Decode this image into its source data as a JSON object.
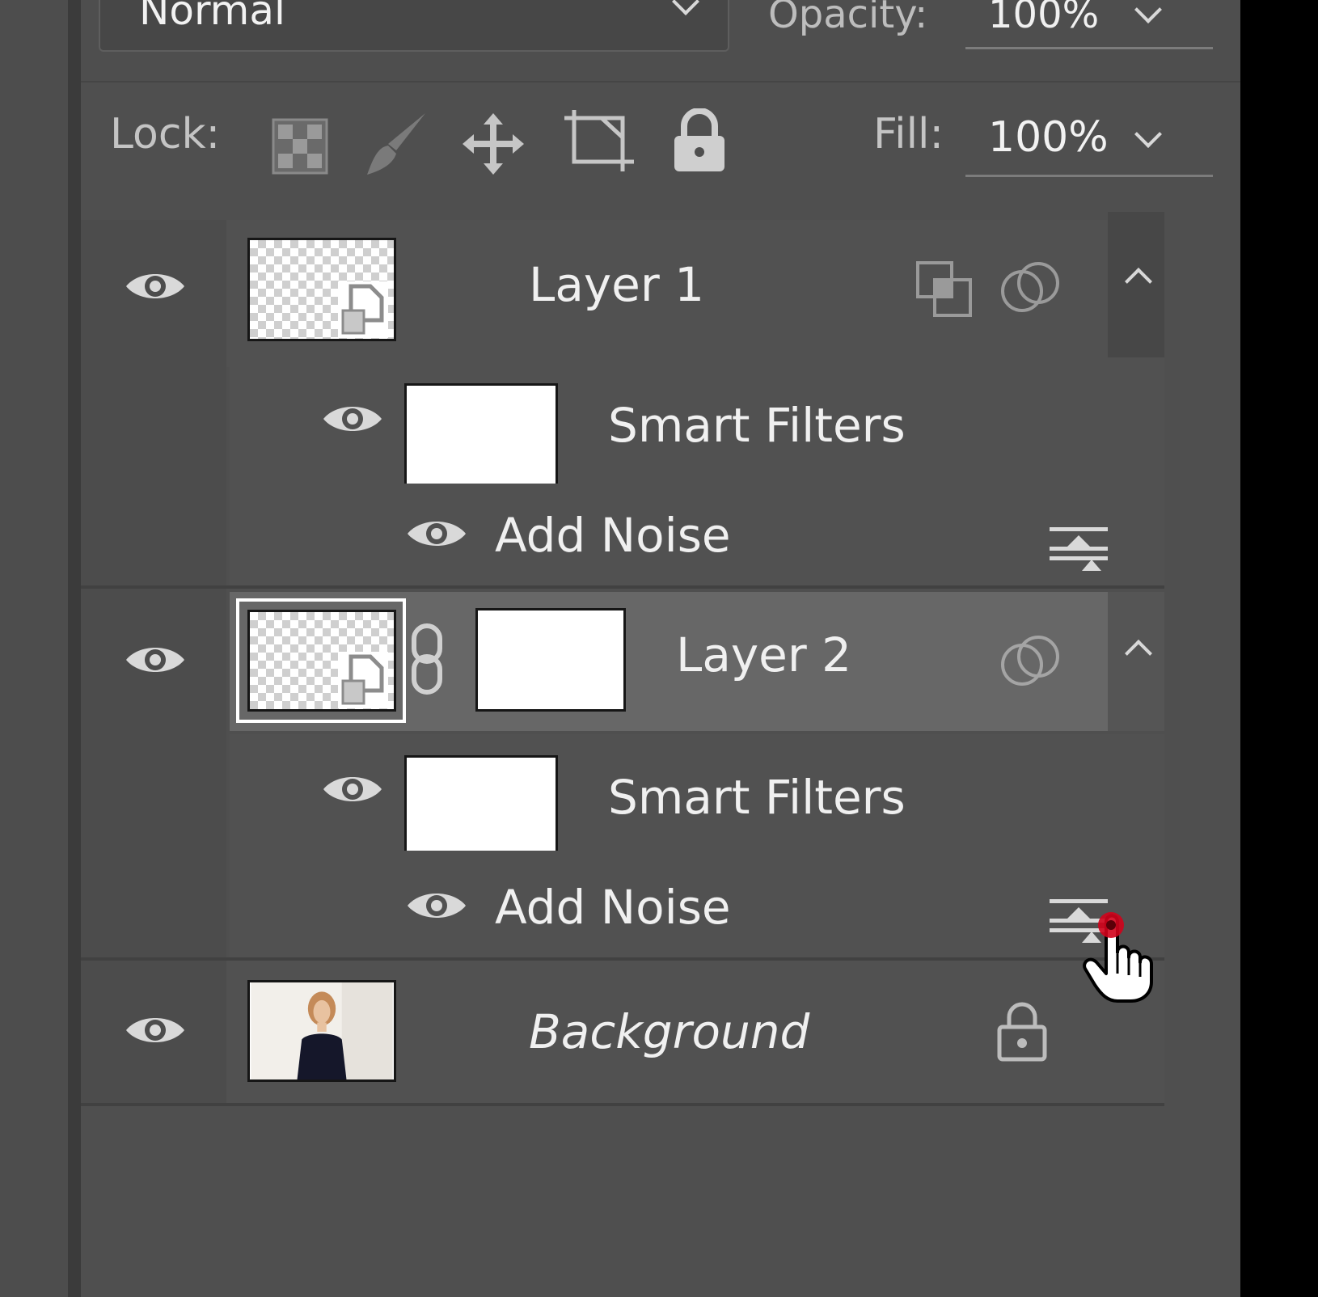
{
  "blend": {
    "mode": "Normal",
    "opacity_label": "Opacity:",
    "opacity_value": "100%"
  },
  "lock": {
    "label": "Lock:",
    "fill_label": "Fill:",
    "fill_value": "100%"
  },
  "layers": [
    {
      "name": "Layer 1",
      "smart_filters": "Smart Filters",
      "filter": "Add Noise"
    },
    {
      "name": "Layer 2",
      "smart_filters": "Smart Filters",
      "filter": "Add Noise"
    },
    {
      "name": "Background"
    }
  ],
  "colors": {
    "panel": "#4f4f4f",
    "selected_row": "#676767",
    "cursor_dot": "#d0021b"
  },
  "icons": [
    "eye-icon",
    "lock-transparent-icon",
    "brush-icon",
    "move-icon",
    "artboard-icon",
    "lock-icon",
    "smart-object-icon",
    "link-icon",
    "blend-options-icon",
    "fx-icon",
    "chevron-up-icon",
    "hand-cursor-icon"
  ]
}
